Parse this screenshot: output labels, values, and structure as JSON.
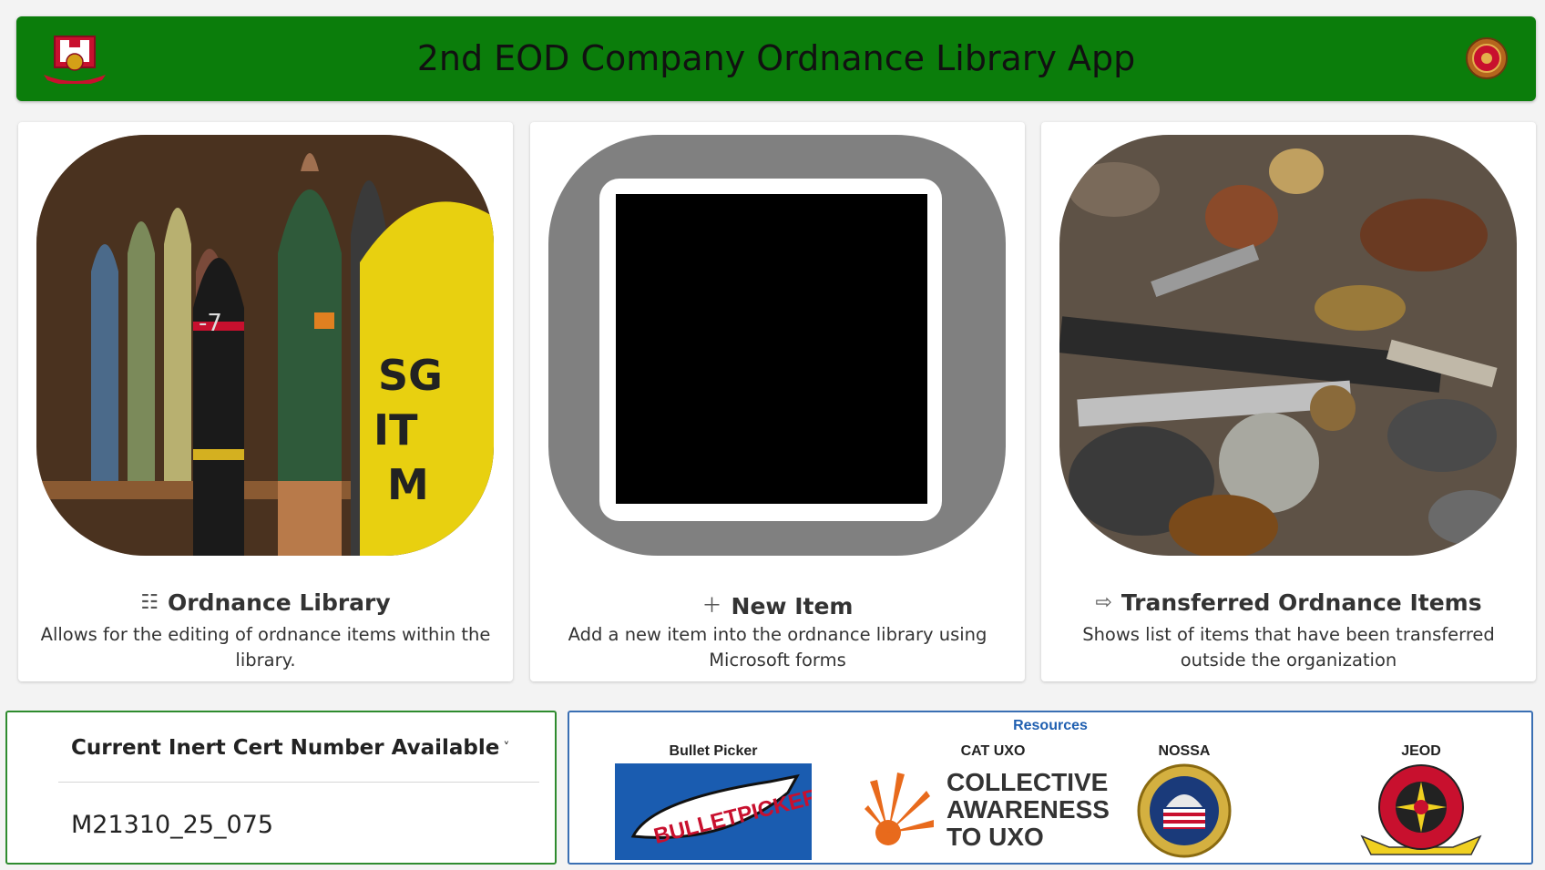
{
  "header": {
    "title": "2nd EOD Company Ordnance Library App",
    "color": "#0b7d0b"
  },
  "cards": [
    {
      "icon": "list-icon",
      "title": "Ordnance Library",
      "description": "Allows for the editing of ordnance items within the library."
    },
    {
      "icon": "plus-icon",
      "title": "New Item",
      "description": "Add a new item into the ordnance library using Microsoft forms"
    },
    {
      "icon": "transfer-icon",
      "title": "Transferred Ordnance Items",
      "description": "Shows list of items that have been transferred outside the organization"
    }
  ],
  "cert": {
    "label": "Current Inert Cert Number Available",
    "value": "M21310_25_075"
  },
  "resources": {
    "title": "Resources",
    "items": [
      {
        "label": "Bullet Picker",
        "logo_text": "BULLETPICKER"
      },
      {
        "label": "CAT UXO",
        "logo_text": [
          "COLLECTIVE",
          "AWARENESS",
          "TO UXO"
        ]
      },
      {
        "label": "NOSSA"
      },
      {
        "label": "JEOD"
      }
    ]
  }
}
